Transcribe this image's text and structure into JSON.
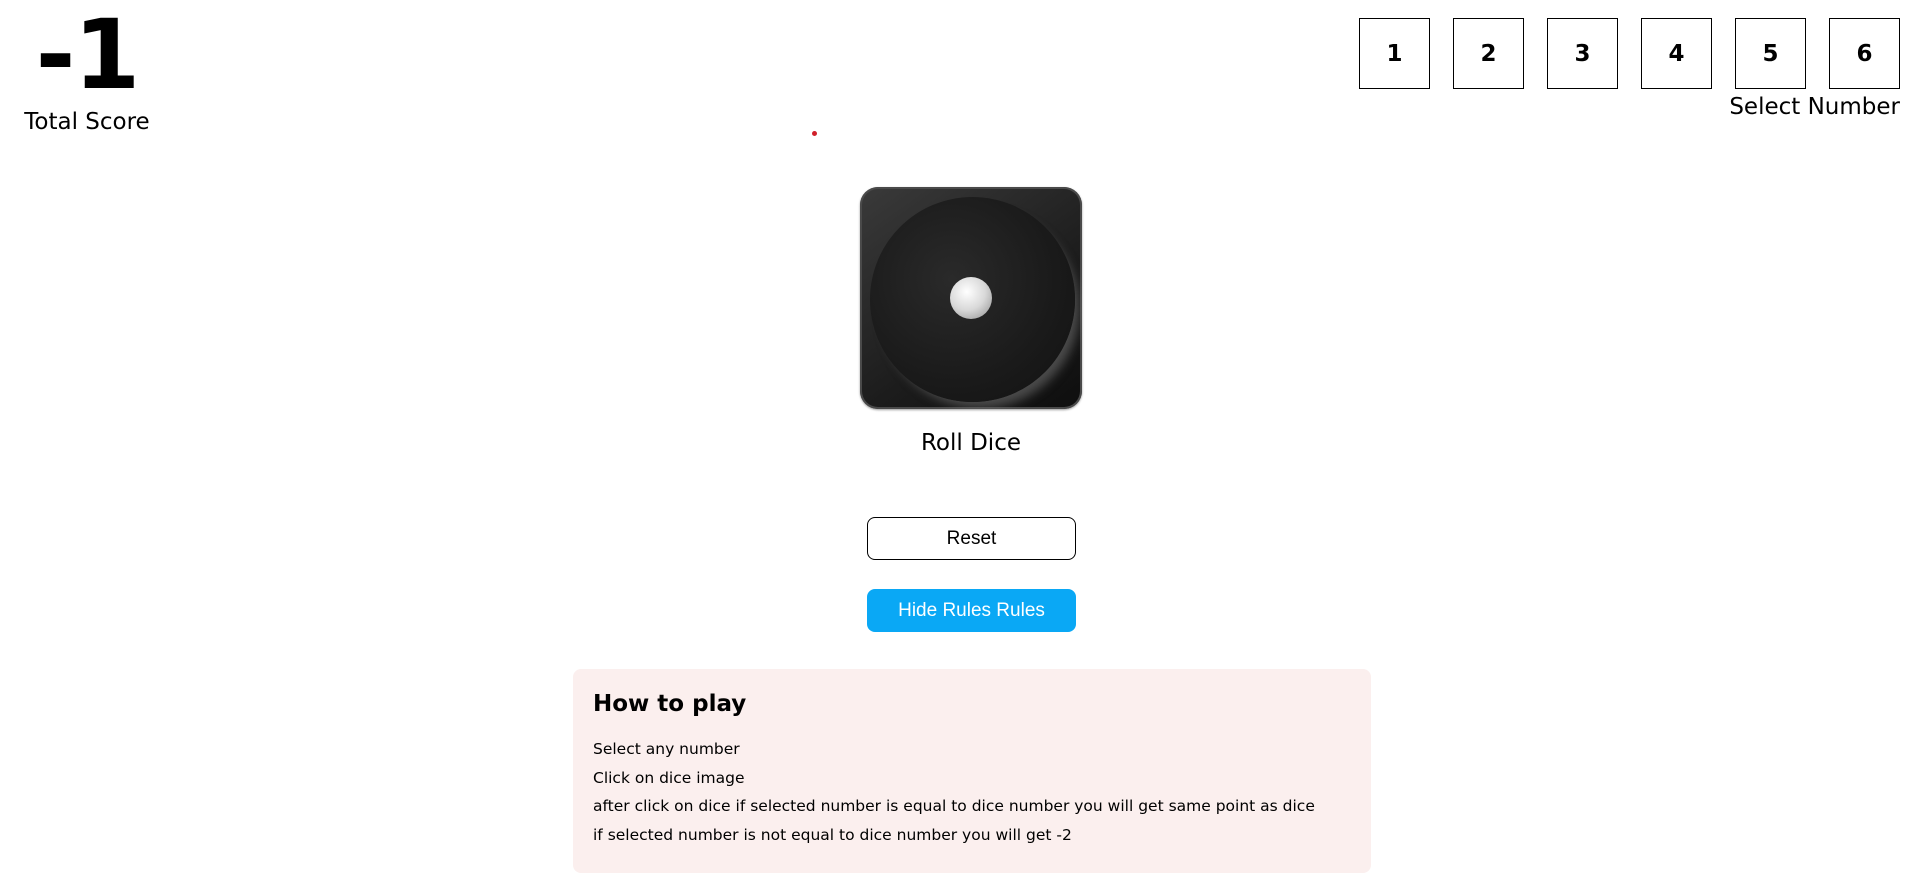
{
  "score": {
    "value": "-1",
    "label": "Total Score"
  },
  "selector": {
    "numbers": [
      "1",
      "2",
      "3",
      "4",
      "5",
      "6"
    ],
    "label": "Select Number"
  },
  "dice": {
    "current_face": 1,
    "roll_label": "Roll Dice"
  },
  "buttons": {
    "reset_label": "Reset",
    "rules_label": "Hide Rules Rules",
    "rules_color": "#0aa8f5"
  },
  "rules": {
    "title": "How to play",
    "lines": [
      "Select any number",
      "Click on dice image",
      "after click on dice if selected number is equal to dice number you will get same point as dice",
      "if selected number is not equal to dice number you will get -2"
    ],
    "background": "#fbefee"
  }
}
